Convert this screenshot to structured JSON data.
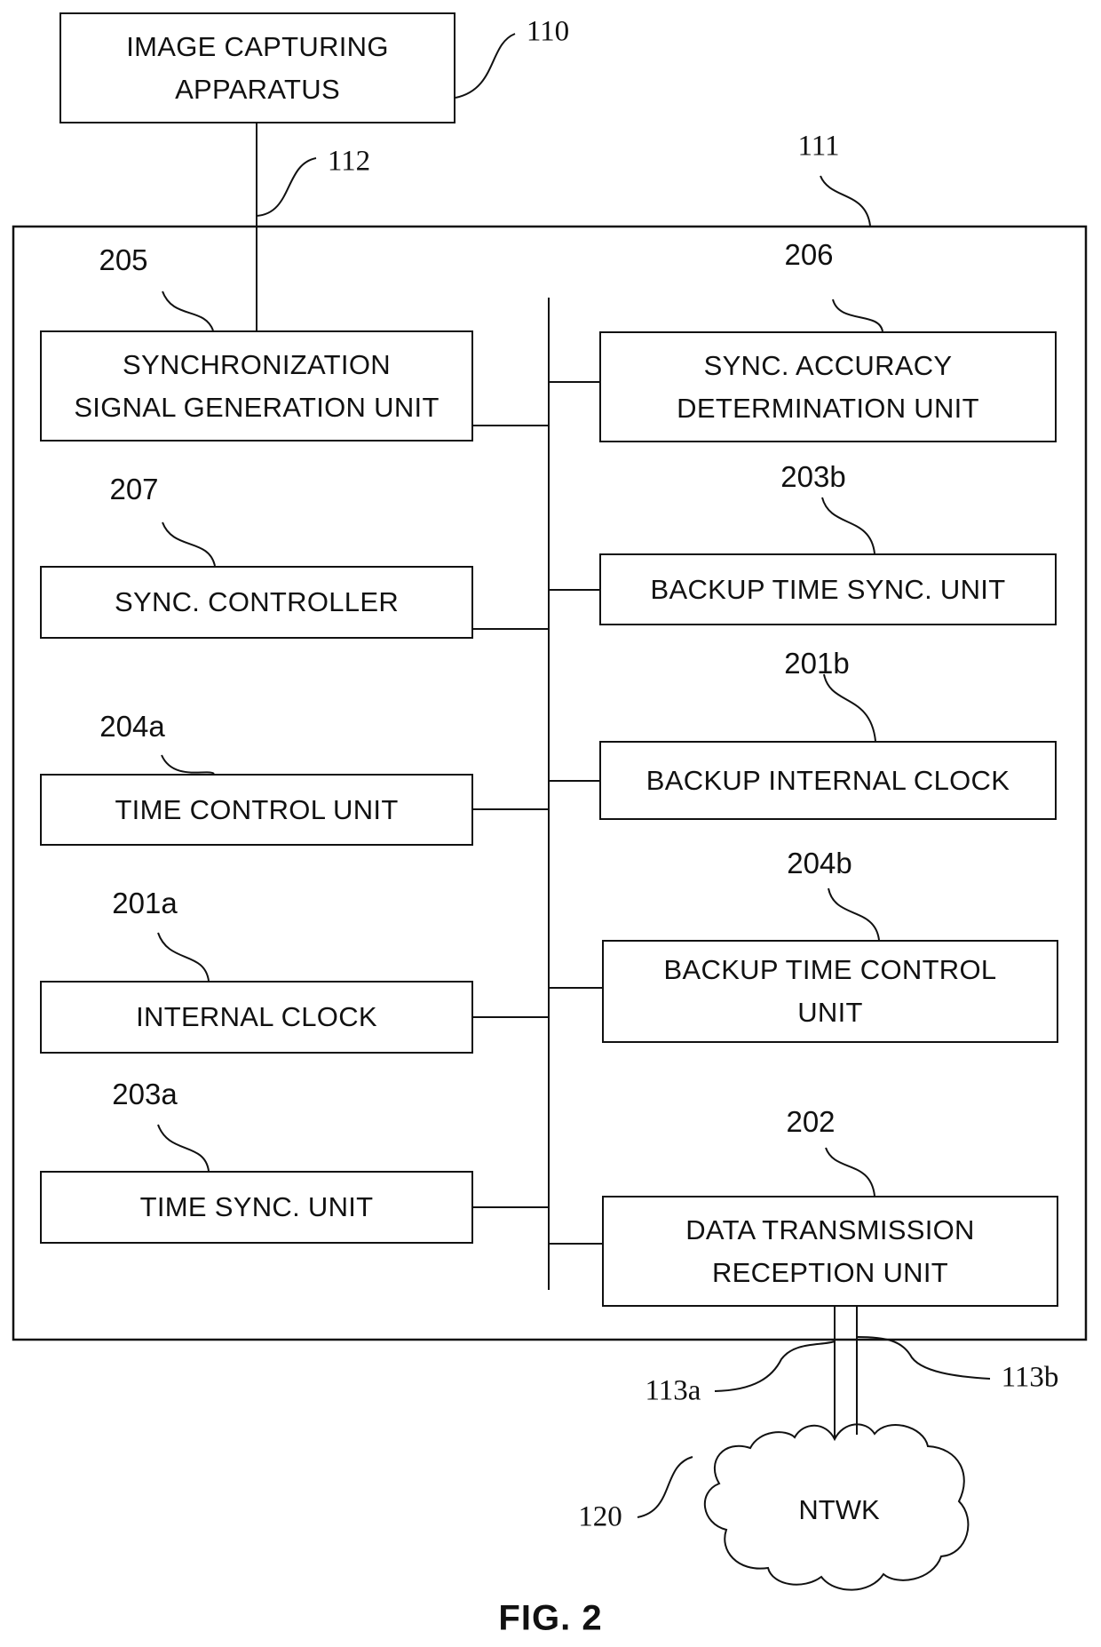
{
  "figure": {
    "caption": "FIG. 2",
    "top_block": {
      "ref": "110",
      "label": "IMAGE CAPTURING\nAPPARATUS"
    },
    "link_ref": "112",
    "device": {
      "ref": "111",
      "left_units": [
        {
          "ref": "205",
          "label": "SYNCHRONIZATION\nSIGNAL GENERATION UNIT"
        },
        {
          "ref": "207",
          "label": "SYNC. CONTROLLER"
        },
        {
          "ref": "204a",
          "label": "TIME CONTROL UNIT"
        },
        {
          "ref": "201a",
          "label": "INTERNAL CLOCK"
        },
        {
          "ref": "203a",
          "label": "TIME SYNC. UNIT"
        }
      ],
      "right_units": [
        {
          "ref": "206",
          "label": "SYNC. ACCURACY\nDETERMINATION UNIT"
        },
        {
          "ref": "203b",
          "label": "BACKUP TIME SYNC. UNIT"
        },
        {
          "ref": "201b",
          "label": "BACKUP INTERNAL CLOCK"
        },
        {
          "ref": "204b",
          "label": "BACKUP TIME CONTROL\nUNIT"
        },
        {
          "ref": "202",
          "label": "DATA TRANSMISSION\nRECEPTION UNIT"
        }
      ]
    },
    "network": {
      "ref": "120",
      "label": "NTWK",
      "links": [
        {
          "ref": "113a"
        },
        {
          "ref": "113b"
        }
      ]
    }
  }
}
